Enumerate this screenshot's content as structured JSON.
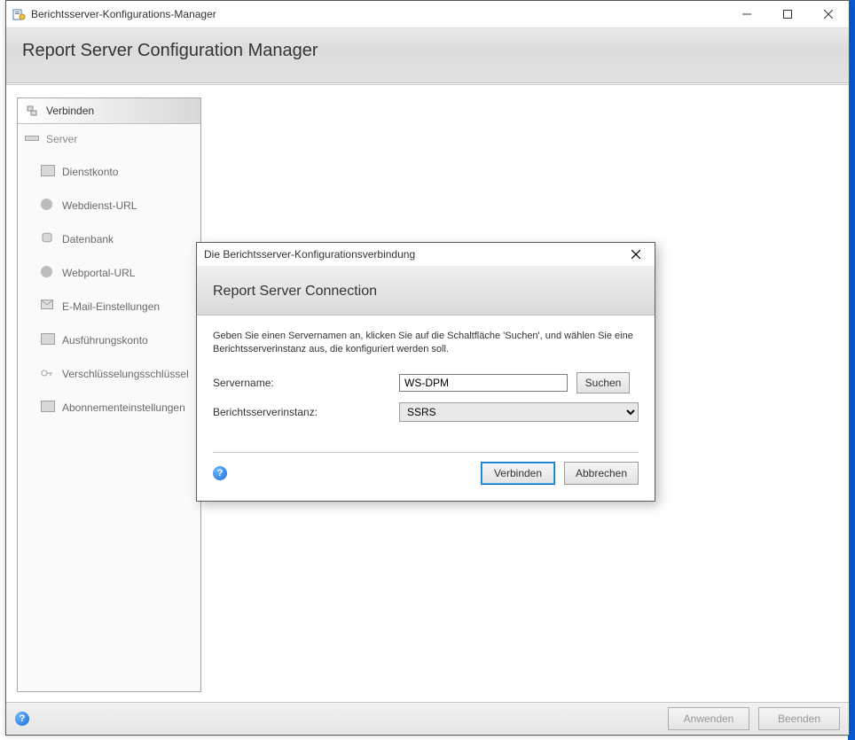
{
  "window": {
    "title": "Berichtsserver-Konfigurations-Manager"
  },
  "header": {
    "title": "Report Server Configuration Manager"
  },
  "sidebar": {
    "connect": "Verbinden",
    "server_section": "Server",
    "items": [
      "Dienstkonto",
      "Webdienst-URL",
      "Datenbank",
      "Webportal-URL",
      "E-Mail-Einstellungen",
      "Ausführungskonto",
      "Verschlüsselungsschlüssel",
      "Abonnementeinstellungen"
    ]
  },
  "footer": {
    "apply": "Anwenden",
    "exit": "Beenden"
  },
  "dialog": {
    "title": "Die Berichtsserver-Konfigurationsverbindung",
    "heading": "Report Server Connection",
    "instructions": "Geben Sie einen Servernamen an, klicken Sie auf die Schaltfläche 'Suchen', und wählen Sie eine Berichtsserverinstanz aus, die konfiguriert werden soll.",
    "servername_label": "Servername:",
    "servername_value": "WS-DPM",
    "search_button": "Suchen",
    "instance_label": "Berichtsserverinstanz:",
    "instance_value": "SSRS",
    "connect_button": "Verbinden",
    "cancel_button": "Abbrechen"
  }
}
